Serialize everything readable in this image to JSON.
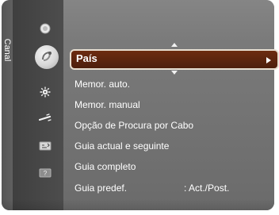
{
  "menu": {
    "side_tab": "Canal",
    "selected_item": "País",
    "items": [
      "Memor. auto.",
      "Memor. manual",
      "Opção de Procura por Cabo",
      "Guia actual e seguinte",
      "Guia completo",
      "Guia predef."
    ],
    "guide_default_value": ": Act./Post."
  },
  "icons": {
    "top": "signal-icon",
    "selected": "satellite-dish-icon",
    "settings": "gear-icon",
    "link": "wand-icon",
    "guide": "tv-guide-icon",
    "help": "help-icon"
  },
  "colors": {
    "panel_gray": "#7a7a7a",
    "highlight_brown": "#5b240d",
    "text_white": "#ffffff"
  }
}
